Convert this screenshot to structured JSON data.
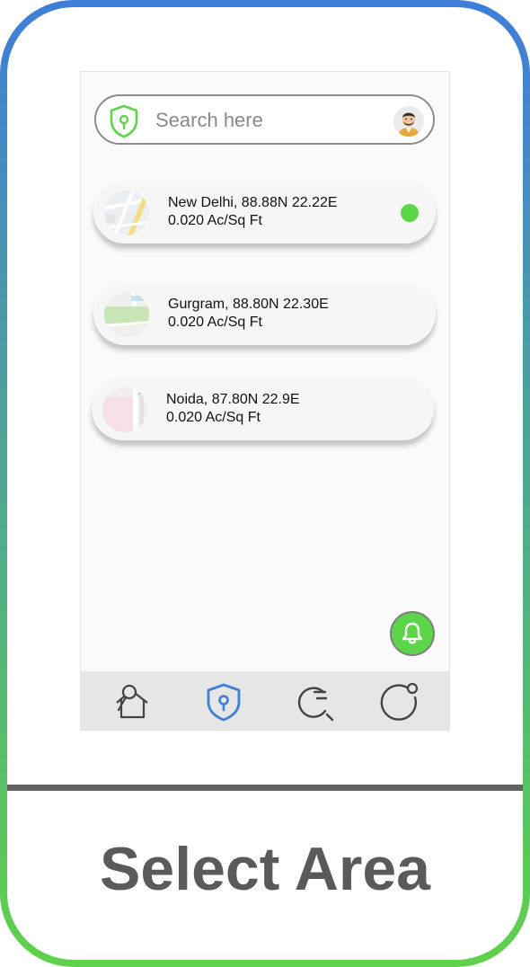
{
  "search": {
    "placeholder": "Search here"
  },
  "locations": [
    {
      "title": "New Delhi, 88.88N 22.22E",
      "area": "0.020 Ac/Sq Ft",
      "selected": true
    },
    {
      "title": "Gurgram, 88.80N 22.30E",
      "area": "0.020 Ac/Sq Ft",
      "selected": false
    },
    {
      "title": "Noida, 87.80N 22.9E",
      "area": "0.020 Ac/Sq Ft",
      "selected": false
    }
  ],
  "nav": {
    "items": [
      "home-pin-icon",
      "shield-pin-icon",
      "search-list-icon",
      "profile-circle-icon"
    ],
    "active": "shield-pin-icon"
  },
  "caption": "Select Area",
  "colors": {
    "accent_green": "#5cd648",
    "active_blue": "#3f7fd8",
    "frame_top": "#3f7ed8",
    "frame_bottom": "#5fd14a"
  }
}
